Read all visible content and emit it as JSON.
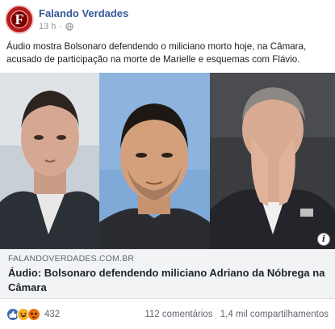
{
  "post": {
    "page_name": "Falando Verdades",
    "avatar_letter": "F",
    "time": "13 h",
    "separator": "·",
    "caption": "Áudio mostra Bolsonaro defendendo o miliciano morto hoje, na Câmara, acusado de participação na morte de Marielle e esquemas com Flávio."
  },
  "link_preview": {
    "domain": "FALANDOVERDADES.COM.BR",
    "title": "Áudio: Bolsonaro defendendo miliciano Adriano da Nóbrega na Câmara",
    "info_glyph": "i"
  },
  "footer": {
    "reactions": [
      "like-icon",
      "haha-icon",
      "angry-icon"
    ],
    "reaction_count": "432",
    "comments": "112 comentários",
    "shares": "1,4 mil compartilhamentos"
  },
  "colors": {
    "page_name": "#365899",
    "link_bg": "#f2f3f5",
    "like": "#4267b2",
    "haha": "#f7b125",
    "angry": "#e9710f"
  }
}
